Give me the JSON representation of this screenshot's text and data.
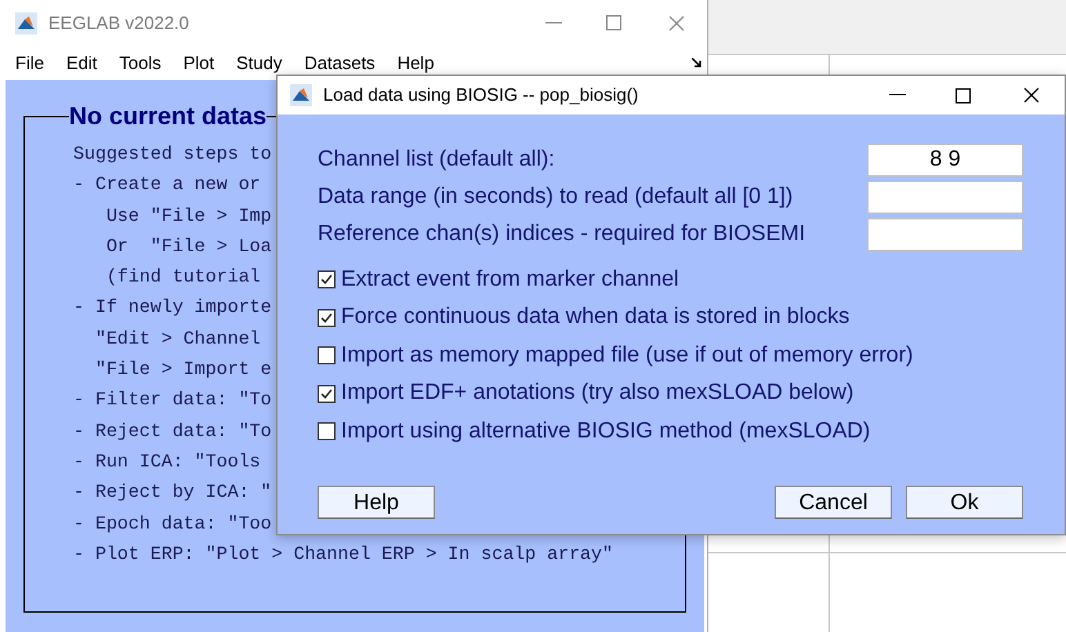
{
  "main_window": {
    "title": "EEGLAB v2022.0",
    "menu": [
      "File",
      "Edit",
      "Tools",
      "Plot",
      "Study",
      "Datasets",
      "Help"
    ],
    "panel": {
      "heading": "No current datas",
      "lines": [
        "Suggested steps to",
        "- Create a new or",
        "   Use \"File > Imp",
        "   Or  \"File > Loa",
        "   (find tutorial",
        "- If newly importe",
        "  \"Edit > Channel",
        "  \"File > Import e",
        "- Filter data: \"To",
        "- Reject data: \"To",
        "- Run ICA: \"Tools",
        "- Reject by ICA: \"",
        "- Epoch data: \"Too",
        "- Plot ERP: \"Plot > Channel ERP > In scalp array\""
      ]
    }
  },
  "dialog": {
    "title": "Load data using BIOSIG -- pop_biosig()",
    "fields": [
      {
        "label": "Channel list (default all):",
        "value": "8 9"
      },
      {
        "label": "Data range (in seconds) to read (default all [0 1])"
      },
      {
        "label": "Reference chan(s) indices - required for BIOSEMI"
      }
    ],
    "options": [
      {
        "label": "Extract event from marker channel",
        "checked": true
      },
      {
        "label": "Force continuous data when data is stored in blocks",
        "checked": true
      },
      {
        "label": "Import as memory mapped file (use if out of memory error)",
        "checked": false
      },
      {
        "label": "Import EDF+ anotations (try also mexSLOAD below)",
        "checked": true
      },
      {
        "label": "Import using alternative BIOSIG method (mexSLOAD)",
        "checked": false
      }
    ],
    "buttons": [
      "Help",
      "Cancel",
      "Ok"
    ]
  }
}
